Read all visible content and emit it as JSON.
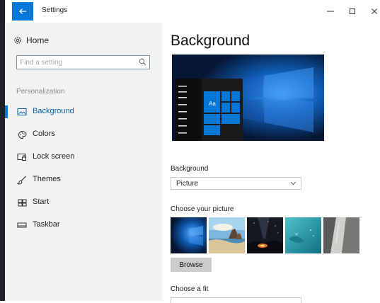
{
  "window": {
    "title": "Settings"
  },
  "icons": {
    "back": "arrow-left-icon",
    "minimize": "minimize-icon",
    "maximize": "maximize-icon",
    "close": "close-icon",
    "home": "gear-icon",
    "search": "search-icon"
  },
  "colors": {
    "accent": "#0078d7",
    "sidebar_bg": "#f2f2f2",
    "button_bg": "#cccccc"
  },
  "sidebar": {
    "home_label": "Home",
    "search_placeholder": "Find a setting",
    "section_label": "Personalization",
    "items": [
      {
        "label": "Background",
        "icon": "picture-icon",
        "active": true
      },
      {
        "label": "Colors",
        "icon": "palette-icon",
        "active": false
      },
      {
        "label": "Lock screen",
        "icon": "lock-screen-icon",
        "active": false
      },
      {
        "label": "Themes",
        "icon": "brush-icon",
        "active": false
      },
      {
        "label": "Start",
        "icon": "start-tiles-icon",
        "active": false
      },
      {
        "label": "Taskbar",
        "icon": "taskbar-icon",
        "active": false
      }
    ]
  },
  "main": {
    "title": "Background",
    "preview": {
      "tile_text": "Aa"
    },
    "background_label": "Background",
    "background_value": "Picture",
    "choose_picture_label": "Choose your picture",
    "pictures": [
      {
        "name": "windows-hero"
      },
      {
        "name": "beach-rocks"
      },
      {
        "name": "night-sky"
      },
      {
        "name": "underwater"
      },
      {
        "name": "rock-cliff"
      }
    ],
    "browse_label": "Browse",
    "choose_fit_label": "Choose a fit"
  }
}
